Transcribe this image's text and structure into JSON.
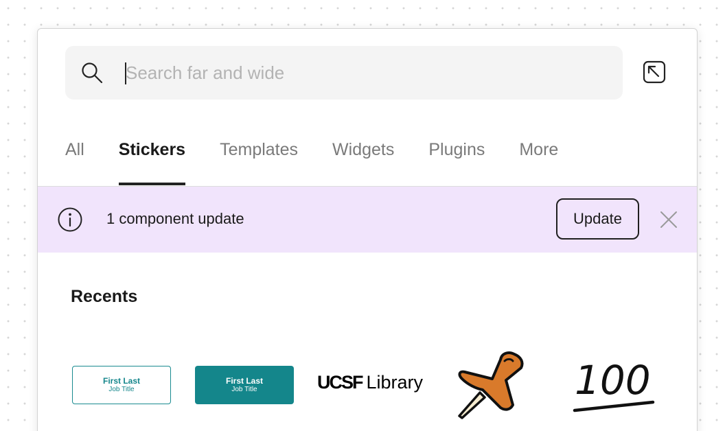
{
  "search": {
    "placeholder": "Search far and wide",
    "value": ""
  },
  "tabs": [
    {
      "label": "All",
      "active": false
    },
    {
      "label": "Stickers",
      "active": true
    },
    {
      "label": "Templates",
      "active": false
    },
    {
      "label": "Widgets",
      "active": false
    },
    {
      "label": "Plugins",
      "active": false
    },
    {
      "label": "More",
      "active": false
    }
  ],
  "banner": {
    "message": "1 component update",
    "button_label": "Update",
    "background_color": "#f1e4fc"
  },
  "recents": {
    "title": "Recents",
    "items": [
      {
        "kind": "namecard-outline",
        "name": "First Last",
        "subtitle": "Job Title"
      },
      {
        "kind": "namecard-filled",
        "name": "First Last",
        "subtitle": "Job Title"
      },
      {
        "kind": "logo",
        "mark": "UCSF",
        "text": "Library"
      },
      {
        "kind": "sticker",
        "icon": "pushpin-icon"
      },
      {
        "kind": "sticker",
        "icon": "hundred-points-icon",
        "text": "100"
      }
    ]
  },
  "colors": {
    "accent_teal": "#14868b",
    "pin_orange": "#d97a2b"
  }
}
